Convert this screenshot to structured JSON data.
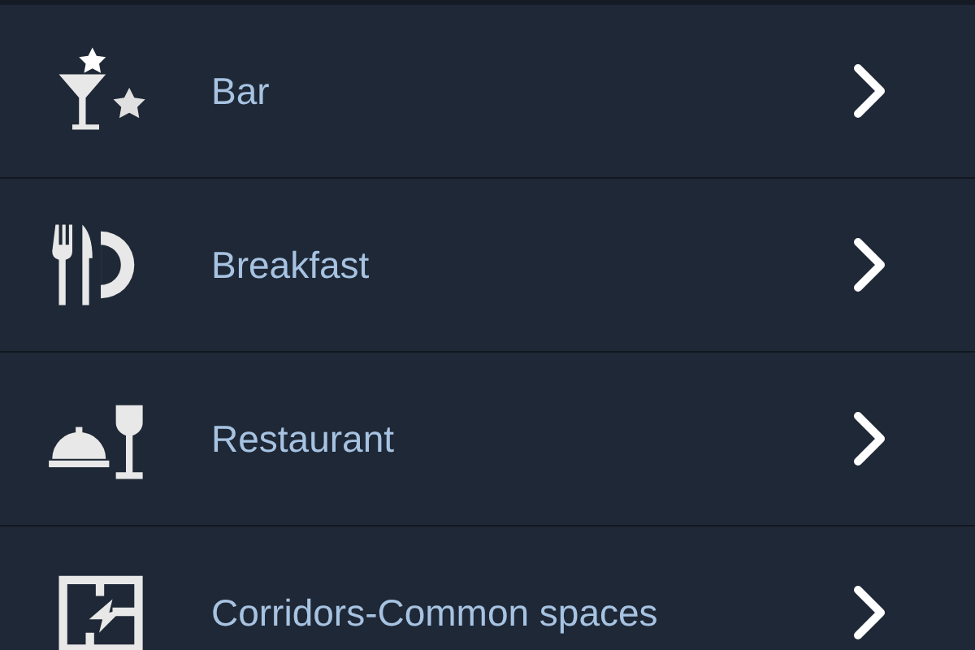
{
  "menu_items": [
    {
      "label": "Bar"
    },
    {
      "label": "Breakfast"
    },
    {
      "label": "Restaurant"
    },
    {
      "label": "Corridors-Common spaces"
    }
  ]
}
